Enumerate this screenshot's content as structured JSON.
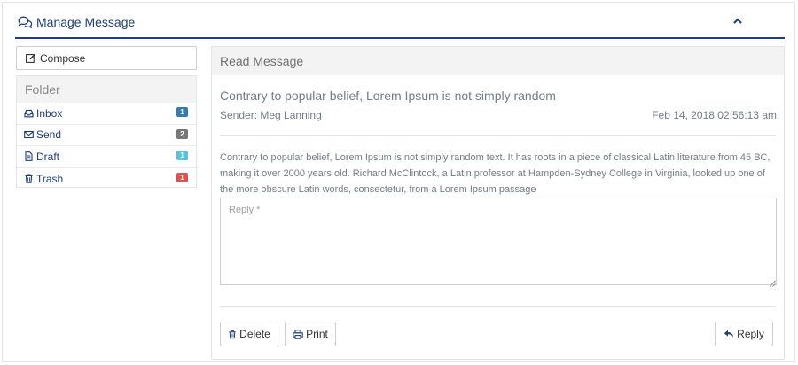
{
  "header": {
    "title": "Manage Message",
    "icon": "comments-icon",
    "collapse_icon": "chevron-up-icon"
  },
  "sidebar": {
    "compose_label": "Compose",
    "folder_heading": "Folder",
    "folders": [
      {
        "label": "Inbox",
        "icon": "inbox-icon",
        "count": "1",
        "badge_color": "#337ab7"
      },
      {
        "label": "Send",
        "icon": "envelope-icon",
        "count": "2",
        "badge_color": "#777777"
      },
      {
        "label": "Draft",
        "icon": "file-icon",
        "count": "1",
        "badge_color": "#5bc0de"
      },
      {
        "label": "Trash",
        "icon": "trash-icon",
        "count": "1",
        "badge_color": "#d9534f"
      }
    ]
  },
  "message": {
    "panel_heading": "Read Message",
    "subject": "Contrary to popular belief, Lorem Ipsum is not simply random",
    "sender": "Sender: Meg Lanning",
    "date": "Feb 14, 2018 02:56:13 am",
    "body": "Contrary to popular belief, Lorem Ipsum is not simply random text. It has roots in a piece of classical Latin literature from 45 BC, making it over 2000 years old. Richard McClintock, a Latin professor at Hampden-Sydney College in Virginia, looked up one of the more obscure Latin words, consectetur, from a Lorem Ipsum passage"
  },
  "reply_form": {
    "placeholder": "Reply *",
    "value": ""
  },
  "actions": {
    "delete_label": "Delete",
    "print_label": "Print",
    "reply_label": "Reply"
  },
  "colors": {
    "accent": "#1f3f7a",
    "muted_text": "#6f7d8c"
  }
}
